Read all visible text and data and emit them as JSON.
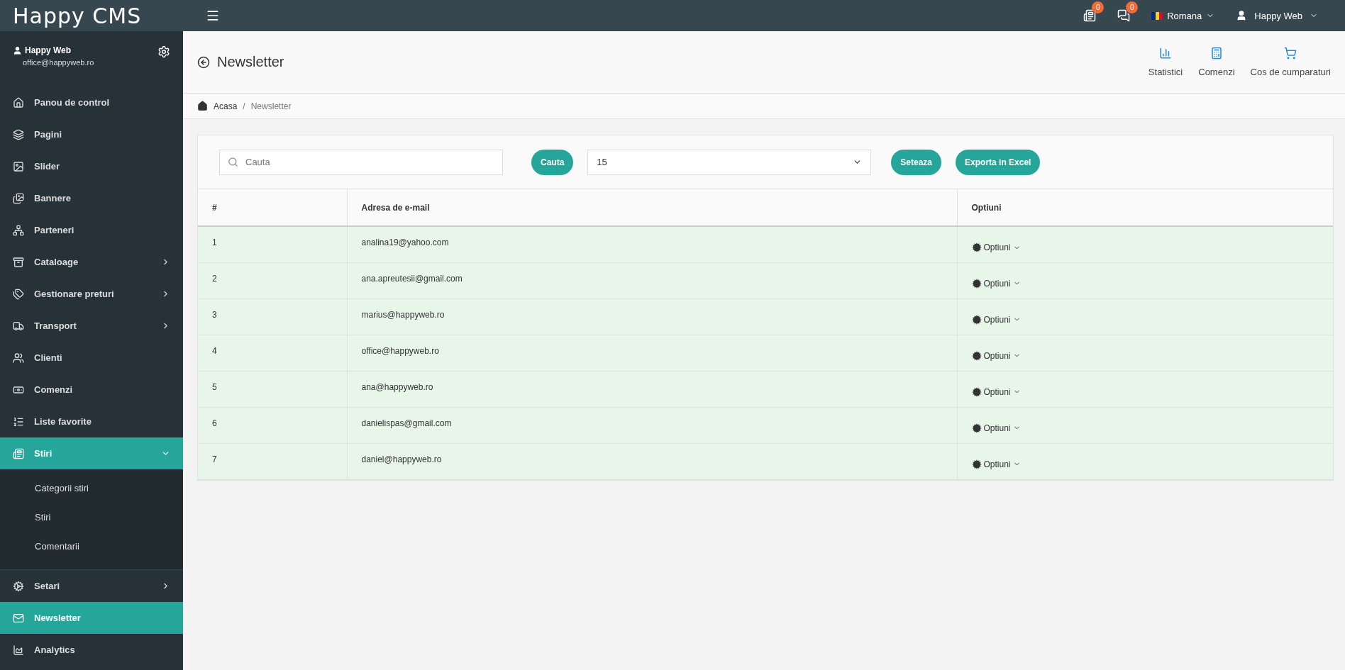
{
  "topbar": {
    "logo": "Happy CMS",
    "notifications": [
      {
        "count": "0"
      },
      {
        "count": "0"
      }
    ],
    "language": "Romana",
    "user": "Happy Web"
  },
  "sidebar": {
    "profile": {
      "name": "Happy Web",
      "email": "office@happyweb.ro"
    },
    "items": [
      {
        "label": "Panou de control",
        "kind": "link",
        "selected": false
      },
      {
        "label": "Pagini",
        "kind": "link",
        "selected": false
      },
      {
        "label": "Slider",
        "kind": "link",
        "selected": false
      },
      {
        "label": "Bannere",
        "kind": "link",
        "selected": false
      },
      {
        "label": "Parteneri",
        "kind": "link",
        "selected": false
      },
      {
        "label": "Cataloage",
        "kind": "group",
        "selected": false,
        "expanded": false
      },
      {
        "label": "Gestionare preturi",
        "kind": "group",
        "selected": false,
        "expanded": false
      },
      {
        "label": "Transport",
        "kind": "group",
        "selected": false,
        "expanded": false
      },
      {
        "label": "Clienti",
        "kind": "link",
        "selected": false
      },
      {
        "label": "Comenzi",
        "kind": "link",
        "selected": false
      },
      {
        "label": "Liste favorite",
        "kind": "link",
        "selected": false
      },
      {
        "label": "Stiri",
        "kind": "group",
        "selected": true,
        "expanded": true,
        "children": [
          {
            "label": "Categorii stiri"
          },
          {
            "label": "Stiri"
          },
          {
            "label": "Comentarii"
          }
        ]
      },
      {
        "label": "Setari",
        "kind": "group",
        "selected": false,
        "expanded": false
      },
      {
        "label": "Newsletter",
        "kind": "link",
        "selected": true
      },
      {
        "label": "Analytics",
        "kind": "link",
        "selected": false
      }
    ]
  },
  "header": {
    "title": "Newsletter",
    "quick_links": [
      {
        "label": "Statistici"
      },
      {
        "label": "Comenzi"
      },
      {
        "label": "Cos de cumparaturi"
      }
    ]
  },
  "breadcrumb": {
    "separator": "/",
    "items": [
      {
        "label": "Acasa"
      },
      {
        "label": "Newsletter"
      }
    ]
  },
  "toolbar": {
    "search": {
      "placeholder": "Cauta"
    },
    "search_button": "Cauta",
    "per_page": "15",
    "set_button": "Seteaza",
    "export_button": "Exporta in Excel"
  },
  "table": {
    "columns": [
      "#",
      "Adresa de e-mail",
      "Optiuni"
    ],
    "rows": [
      {
        "number": "1",
        "email": "analina19@yahoo.com",
        "options": "Optiuni"
      },
      {
        "number": "2",
        "email": "ana.apreutesii@gmail.com",
        "options": "Optiuni"
      },
      {
        "number": "3",
        "email": "marius@happyweb.ro",
        "options": "Optiuni"
      },
      {
        "number": "4",
        "email": "office@happyweb.ro",
        "options": "Optiuni"
      },
      {
        "number": "5",
        "email": "ana@happyweb.ro",
        "options": "Optiuni"
      },
      {
        "number": "6",
        "email": "danielispas@gmail.com",
        "options": "Optiuni"
      },
      {
        "number": "7",
        "email": "daniel@happyweb.ro",
        "options": "Optiuni"
      }
    ]
  }
}
